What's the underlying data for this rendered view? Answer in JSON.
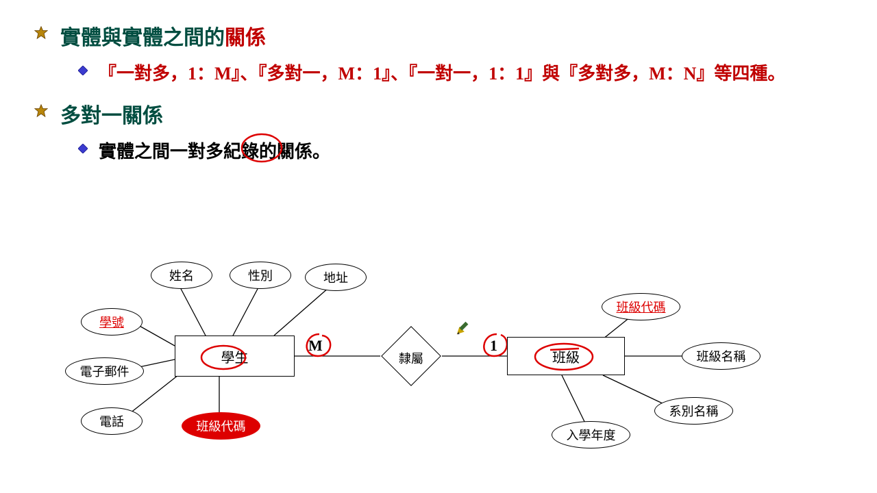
{
  "sections": [
    {
      "title_prefix": "實體與實體之間的",
      "title_red": "關係",
      "sub": "『一對多，1：M』、『多對一，M：1』、『一對一，1：1』與『多對多，M：N』等四種。"
    },
    {
      "title_prefix": "多對一關係",
      "title_red": "",
      "sub": "實體之間一對多紀錄的關係。"
    }
  ],
  "er": {
    "entities": {
      "student": "學生",
      "class": "班級"
    },
    "relationship": "隸屬",
    "cardinality": {
      "student_side": "M",
      "class_side": "1"
    },
    "student_attrs": {
      "name": "姓名",
      "gender": "性別",
      "address": "地址",
      "student_id": "學號",
      "email": "電子郵件",
      "phone": "電話",
      "class_code_fk": "班級代碼"
    },
    "class_attrs": {
      "class_code": "班級代碼",
      "class_name": "班級名稱",
      "dept_name": "系別名稱",
      "enroll_year": "入學年度"
    }
  },
  "annotations": {
    "circled_word": "紀錄"
  }
}
